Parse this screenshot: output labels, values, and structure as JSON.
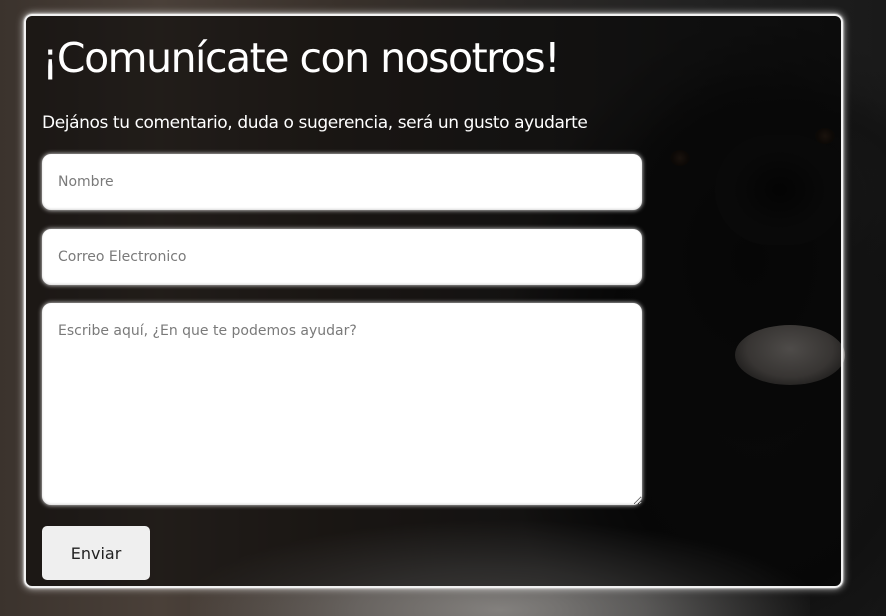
{
  "contact": {
    "title": "¡Comunícate con nosotros!",
    "subtitle": "Dejános tu comentario, duda o sugerencia, será un gusto ayudarte",
    "name_placeholder": "Nombre",
    "email_placeholder": "Correo Electronico",
    "message_placeholder": "Escribe aquí, ¿En que te podemos ayudar?",
    "submit_label": "Enviar"
  },
  "colors": {
    "card_border": "#f2f2f2",
    "input_background": "#ffffff",
    "button_background": "#efefef",
    "text": "#ffffff"
  }
}
